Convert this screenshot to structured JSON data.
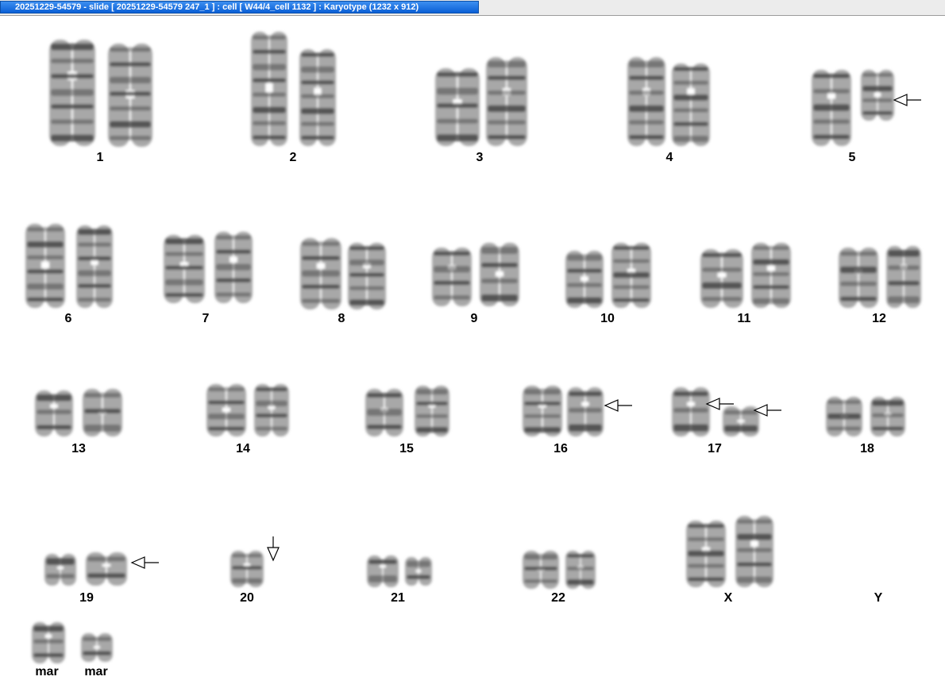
{
  "window": {
    "title": "20251229-54579 - slide [ 20251229-54579 247_1 ] : cell [ W44/4_cell 1132 ] : Karyotype  (1232 x 912)"
  },
  "colors": {
    "title_bar_start": "#3d8ff0",
    "title_bar_end": "#0a5fd6",
    "chromosome_dark": "#3a3a3a",
    "chromosome_light": "#a8a8a8"
  },
  "karyotype": {
    "chromosomes": [
      {
        "label": "1",
        "count": 2,
        "arrows": 0
      },
      {
        "label": "2",
        "count": 2,
        "arrows": 0
      },
      {
        "label": "3",
        "count": 2,
        "arrows": 0
      },
      {
        "label": "4",
        "count": 2,
        "arrows": 0
      },
      {
        "label": "5",
        "count": 2,
        "arrows": 1
      },
      {
        "label": "6",
        "count": 2,
        "arrows": 0
      },
      {
        "label": "7",
        "count": 2,
        "arrows": 0
      },
      {
        "label": "8",
        "count": 2,
        "arrows": 0
      },
      {
        "label": "9",
        "count": 2,
        "arrows": 0
      },
      {
        "label": "10",
        "count": 2,
        "arrows": 0
      },
      {
        "label": "11",
        "count": 2,
        "arrows": 0
      },
      {
        "label": "12",
        "count": 2,
        "arrows": 0
      },
      {
        "label": "13",
        "count": 2,
        "arrows": 0
      },
      {
        "label": "14",
        "count": 2,
        "arrows": 0
      },
      {
        "label": "15",
        "count": 2,
        "arrows": 0
      },
      {
        "label": "16",
        "count": 2,
        "arrows": 1
      },
      {
        "label": "17",
        "count": 2,
        "arrows": 2
      },
      {
        "label": "18",
        "count": 2,
        "arrows": 0
      },
      {
        "label": "19",
        "count": 2,
        "arrows": 1
      },
      {
        "label": "20",
        "count": 1,
        "arrows": 1
      },
      {
        "label": "21",
        "count": 2,
        "arrows": 0
      },
      {
        "label": "22",
        "count": 2,
        "arrows": 0
      },
      {
        "label": "X",
        "count": 2,
        "arrows": 0
      },
      {
        "label": "Y",
        "count": 0,
        "arrows": 0
      },
      {
        "label": "mar",
        "count": 1,
        "arrows": 0
      },
      {
        "label": "mar",
        "count": 1,
        "arrows": 0
      }
    ]
  }
}
